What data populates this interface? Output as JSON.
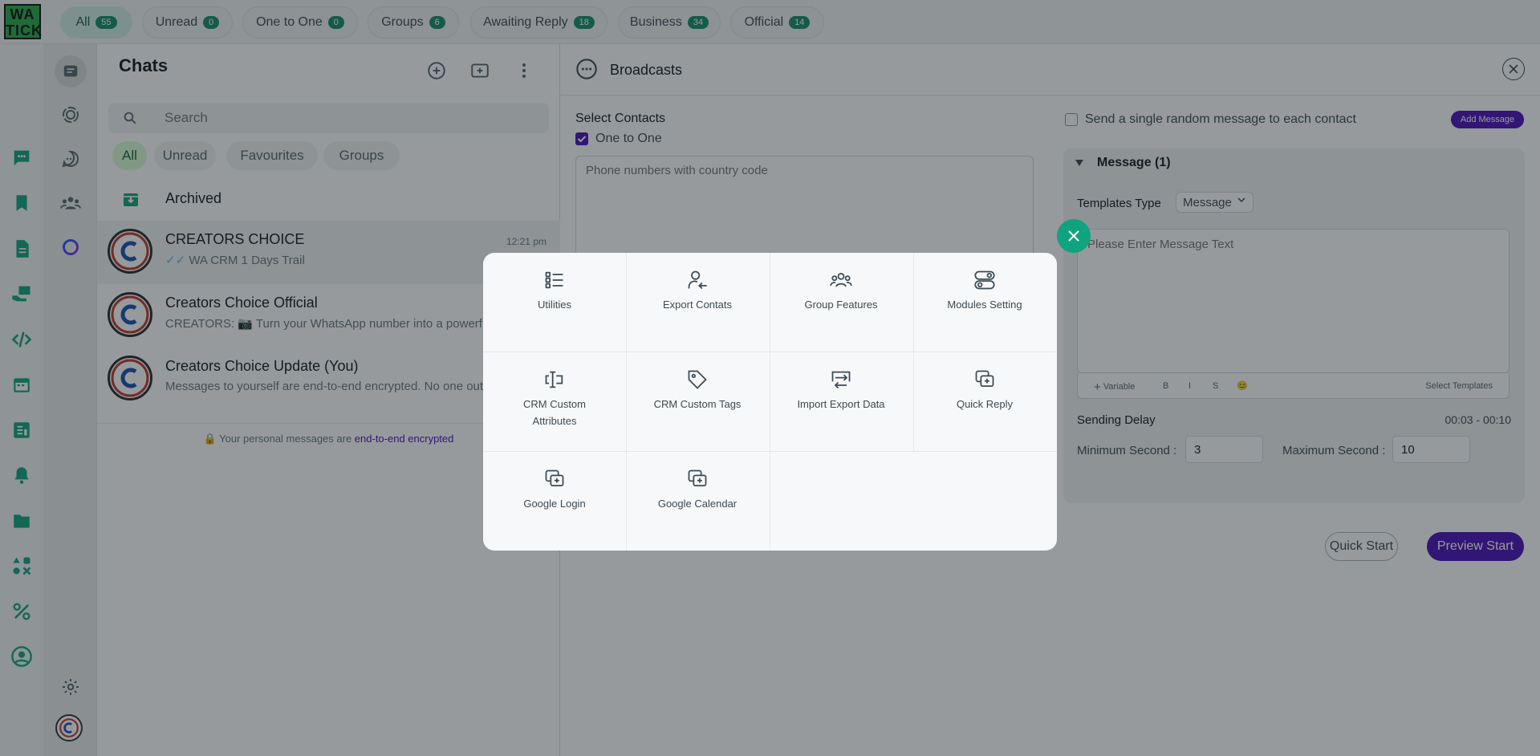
{
  "app": {
    "logo_text": "WA TICK",
    "logo_line1": "WA",
    "logo_line2": "TICK"
  },
  "filter_tabs": [
    {
      "label": "All",
      "count": "55",
      "active": true
    },
    {
      "label": "Unread",
      "count": "0"
    },
    {
      "label": "One to One",
      "count": "0"
    },
    {
      "label": "Groups",
      "count": "6"
    },
    {
      "label": "Awaiting Reply",
      "count": "18"
    },
    {
      "label": "Business",
      "count": "34"
    },
    {
      "label": "Official",
      "count": "14"
    }
  ],
  "left_rail_icons": [
    "chat-bubble-icon",
    "bookmark-icon",
    "document-icon",
    "hand-money-icon",
    "code-icon",
    "calendar-icon",
    "report-icon",
    "bell-icon",
    "folder-icon",
    "apps-icon",
    "percent-icon",
    "user-circle-icon"
  ],
  "nav_rail_icons": [
    "chats-icon",
    "status-icon",
    "channels-icon",
    "communities-icon",
    "meta-ai-icon",
    "settings-icon",
    "profile-avatar"
  ],
  "chats": {
    "title": "Chats",
    "search_placeholder": "Search",
    "chips": [
      "All",
      "Unread",
      "Favourites",
      "Groups"
    ],
    "archived_label": "Archived",
    "items": [
      {
        "name": "CREATORS CHOICE",
        "message": "WA CRM 1 Days Trail",
        "time": "12:21 pm"
      },
      {
        "name": "Creators Choice Official",
        "message": "CREATORS: 📷 Turn your WhatsApp number into a powerful",
        "time": ""
      },
      {
        "name": "Creators Choice Update (You)",
        "message": "Messages to yourself are end-to-end encrypted. No one outside of this chat",
        "time": ""
      }
    ],
    "encryption_prefix": "Your personal messages are ",
    "encryption_link": "end-to-end encrypted"
  },
  "broadcast": {
    "title": "Broadcasts",
    "select_contacts_label": "Select Contacts",
    "one_to_one_label": "One to One",
    "one_to_one_checked": true,
    "phone_placeholder": "Phone numbers with country code",
    "random_message_label": "Send a single random message to each contact",
    "add_message_label": "Add Message",
    "message_section_label": "Message (1)",
    "templates_type_label": "Templates Type",
    "templates_type_value": "Message",
    "message_placeholder": "Please Enter Message Text",
    "toolbar": {
      "variable": "Variable",
      "bold": "B",
      "italic": "I",
      "strike": "S",
      "emoji": "😊",
      "select_templates": "Select Templates"
    },
    "sending_delay_label": "Sending Delay",
    "sending_delay_range": "00:03 - 00:10",
    "min_label": "Minimum Second :",
    "min_value": "3",
    "max_label": "Maximum Second :",
    "max_value": "10",
    "quick_start": "Quick Start",
    "preview_start": "Preview Start"
  },
  "menu": {
    "items": [
      {
        "label": "Utilities",
        "icon": "list-icon"
      },
      {
        "label": "Export Contats",
        "icon": "user-export-icon"
      },
      {
        "label": "Group Features",
        "icon": "group-icon"
      },
      {
        "label": "Modules Setting",
        "icon": "toggle-icon"
      },
      {
        "label": "CRM Custom Attributes",
        "icon": "text-cursor-icon"
      },
      {
        "label": "CRM Custom Tags",
        "icon": "tag-icon"
      },
      {
        "label": "Import Export Data",
        "icon": "import-export-icon"
      },
      {
        "label": "Quick Reply",
        "icon": "quick-reply-icon"
      },
      {
        "label": "Google Login",
        "icon": "google-login-icon"
      },
      {
        "label": "Google Calendar",
        "icon": "google-calendar-icon"
      }
    ]
  },
  "colors": {
    "brand_green": "#10a37f",
    "accent_purple": "#4a0fb8",
    "badge_green": "#178a6a"
  }
}
